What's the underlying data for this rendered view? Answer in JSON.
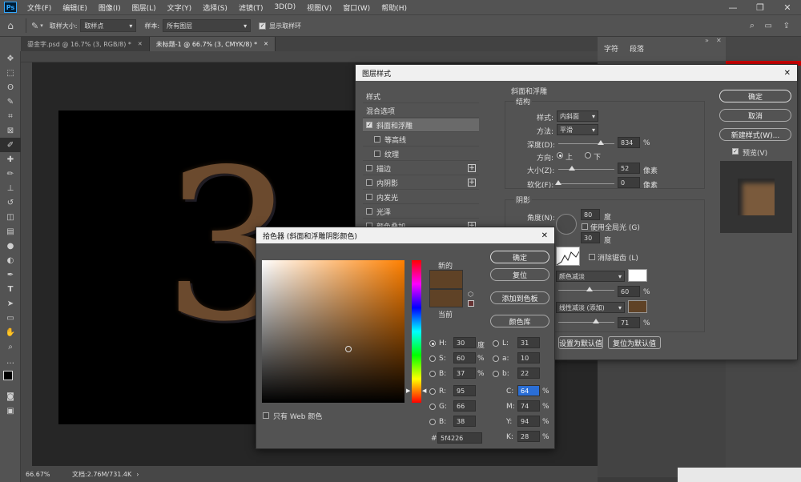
{
  "app": {
    "logo": "Ps"
  },
  "menu": [
    "文件(F)",
    "编辑(E)",
    "图像(I)",
    "图层(L)",
    "文字(Y)",
    "选择(S)",
    "滤镜(T)",
    "3D(D)",
    "视图(V)",
    "窗口(W)",
    "帮助(H)"
  ],
  "window": {
    "minimize": "—",
    "restore": "❐",
    "close": "✕"
  },
  "options": {
    "sample_size_label": "取样大小:",
    "sample_size_value": "取样点",
    "sample_label": "样本:",
    "sample_value": "所有图层",
    "show_ring_label": "显示取样环"
  },
  "tabs": [
    {
      "label": "鎏金字.psd @ 16.7% (3, RGB/8) *",
      "close": "✕"
    },
    {
      "label": "未标题-1 @ 66.7% (3, CMYK/8) *",
      "close": "✕"
    }
  ],
  "canvas": {
    "glyph": "3"
  },
  "status": {
    "zoom": "66.67%",
    "doc": "文档:2.76M/731.4K"
  },
  "right_panel": {
    "tab1": "字符",
    "tab2": "段落"
  },
  "layer_style": {
    "title": "图层样式",
    "close": "✕",
    "sidebar": [
      {
        "label": "样式",
        "check": false,
        "plus": false
      },
      {
        "label": "混合选项",
        "check": false,
        "plus": false
      },
      {
        "label": "斜面和浮雕",
        "check": true,
        "checked": true,
        "plus": false
      },
      {
        "label": "等高线",
        "check": true,
        "checked": false,
        "plus": false,
        "indent": true
      },
      {
        "label": "纹理",
        "check": true,
        "checked": false,
        "plus": false,
        "indent": true
      },
      {
        "label": "描边",
        "check": true,
        "checked": false,
        "plus": true
      },
      {
        "label": "内阴影",
        "check": true,
        "checked": false,
        "plus": true
      },
      {
        "label": "内发光",
        "check": true,
        "checked": false,
        "plus": false
      },
      {
        "label": "光泽",
        "check": true,
        "checked": false,
        "plus": false
      },
      {
        "label": "颜色叠加",
        "check": true,
        "checked": false,
        "plus": true
      }
    ],
    "section_title": "斜面和浮雕",
    "structure_title": "结构",
    "style_label": "样式:",
    "style_value": "内斜面",
    "method_label": "方法:",
    "method_value": "平滑",
    "depth_label": "深度(D):",
    "depth_value": "834",
    "depth_unit": "%",
    "direction_label": "方向:",
    "dir_up": "上",
    "dir_down": "下",
    "size_label": "大小(Z):",
    "size_value": "52",
    "size_unit": "像素",
    "soften_label": "软化(F):",
    "soften_value": "0",
    "soften_unit": "像素",
    "shading_title": "阴影",
    "angle_label": "角度(N):",
    "angle_value": "80",
    "angle_unit": "度",
    "global_light_label": "使用全局光 (G)",
    "altitude_value": "30",
    "altitude_unit": "度",
    "antialias_label": "消除锯齿 (L)",
    "highlight_mode": "颜色减淡",
    "highlight_opacity": "60",
    "shadow_mode": "线性减淡 (添加)",
    "shadow_opacity": "71",
    "pct": "%",
    "highlight_color": "#ffffff",
    "shadow_color": "#5f4226",
    "make_default": "设置为默认值",
    "reset_default": "复位为默认值",
    "ok": "确定",
    "cancel": "取消",
    "new_style": "新建样式(W)...",
    "preview_label": "预览(V)"
  },
  "color_picker": {
    "title": "拾色器 (斜面和浮雕阴影颜色)",
    "close": "✕",
    "new_label": "新的",
    "current_label": "当前",
    "new_color": "#5f4226",
    "current_color": "#5f4226",
    "ok": "确定",
    "reset": "复位",
    "add_swatch": "添加到色板",
    "color_libraries": "颜色库",
    "web_only_label": "只有 Web 颜色",
    "H": "30",
    "H_unit": "度",
    "S": "60",
    "S_unit": "%",
    "B": "37",
    "B_unit": "%",
    "R": "95",
    "G": "66",
    "Bv": "38",
    "L": "31",
    "a": "10",
    "b": "22",
    "C": "64",
    "M": "74",
    "Y": "94",
    "K": "28",
    "pct": "%",
    "hex": "5f4226",
    "hash": "#",
    "labels": {
      "H": "H:",
      "S": "S:",
      "B": "B:",
      "R": "R:",
      "G": "G:",
      "Bb": "B:",
      "L": "L:",
      "a": "a:",
      "b": "b:",
      "C": "C:",
      "M": "M:",
      "Y": "Y:",
      "K": "K:"
    }
  }
}
